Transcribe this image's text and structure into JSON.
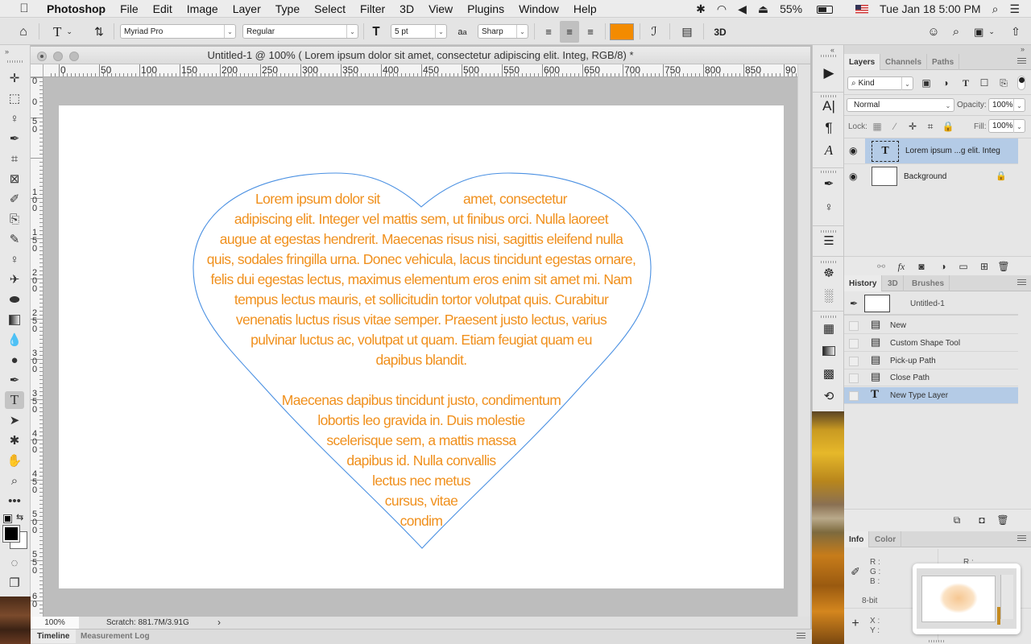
{
  "menubar": {
    "app": "Photoshop",
    "items": [
      "File",
      "Edit",
      "Image",
      "Layer",
      "Type",
      "Select",
      "Filter",
      "3D",
      "View",
      "Plugins",
      "Window",
      "Help"
    ],
    "battery": "55%",
    "datetime": "Tue Jan 18  5:00 PM"
  },
  "options": {
    "font_family": "Myriad Pro",
    "font_style": "Regular",
    "font_size": "5 pt",
    "antialias": "Sharp",
    "text_color": "#f38b00",
    "threed_label": "3D"
  },
  "document": {
    "title": "Untitled-1 @ 100% ( Lorem ipsum dolor sit amet, consectetur adipiscing elit. Integ, RGB/8) *",
    "h_ruler": [
      "0",
      "50",
      "100",
      "150",
      "200",
      "250",
      "300",
      "350",
      "400",
      "450",
      "500",
      "550",
      "600",
      "650",
      "700",
      "750",
      "800",
      "850",
      "90"
    ],
    "v_ruler": [
      "0",
      "0",
      "5\n0",
      "1\n0\n0",
      "1\n5\n0",
      "2\n0\n0",
      "2\n5\n0",
      "3\n0\n0",
      "3\n5\n0",
      "4\n0\n0",
      "4\n5\n0",
      "5\n0\n0",
      "5\n5\n0",
      "6\n0"
    ],
    "text_color": "#f0901d",
    "path_color": "#4a90e2",
    "lines": [
      [
        "Lorem ipsum dolor sit",
        "amet, consectetur"
      ],
      "adipiscing elit. Integer vel mattis sem, ut finibus orci. Nulla laoreet",
      "augue at egestas hendrerit. Maecenas risus nisi, sagittis eleifend nulla",
      "quis, sodales fringilla urna. Donec vehicula, lacus tincidunt egestas ornare,",
      "felis dui egestas lectus, maximus elementum eros enim sit amet mi. Nam",
      "tempus lectus mauris, et sollicitudin tortor volutpat quis. Curabitur",
      "venenatis luctus risus vitae semper. Praesent justo lectus, varius",
      "pulvinar luctus ac, volutpat ut quam. Etiam feugiat quam eu",
      "dapibus blandit.",
      "",
      "Maecenas dapibus tincidunt justo, condimentum",
      "lobortis leo gravida in. Duis molestie",
      "scelerisque sem, a mattis massa",
      "dapibus id. Nulla convallis",
      "lectus nec metus",
      "cursus, vitae",
      "condim"
    ]
  },
  "status": {
    "zoom": "100%",
    "scratch": "Scratch: 881.7M/3.91G"
  },
  "bottom_tabs": [
    "Timeline",
    "Measurement Log"
  ],
  "layers_panel": {
    "tabs": [
      "Layers",
      "Channels",
      "Paths"
    ],
    "filter": "Kind",
    "blend_mode": "Normal",
    "opacity_label": "Opacity:",
    "opacity": "100%",
    "lock_label": "Lock:",
    "fill_label": "Fill:",
    "fill": "100%",
    "layers": [
      {
        "name": "Lorem ipsum ...g elit. Integ",
        "type": "text",
        "selected": true
      },
      {
        "name": "Background",
        "type": "image",
        "locked": true
      }
    ]
  },
  "history_panel": {
    "tabs": [
      "History",
      "3D",
      "Brushes"
    ],
    "snapshot": "Untitled-1",
    "states": [
      "New",
      "Custom Shape Tool",
      "Pick-up Path",
      "Close Path",
      "New Type Layer"
    ]
  },
  "info_panel": {
    "tabs": [
      "Info",
      "Color"
    ],
    "rgb_labels": [
      "R :",
      "G :",
      "B :"
    ],
    "right_label": "R :",
    "bit_depth": "8-bit",
    "xy_labels": [
      "X :",
      "Y :"
    ]
  }
}
